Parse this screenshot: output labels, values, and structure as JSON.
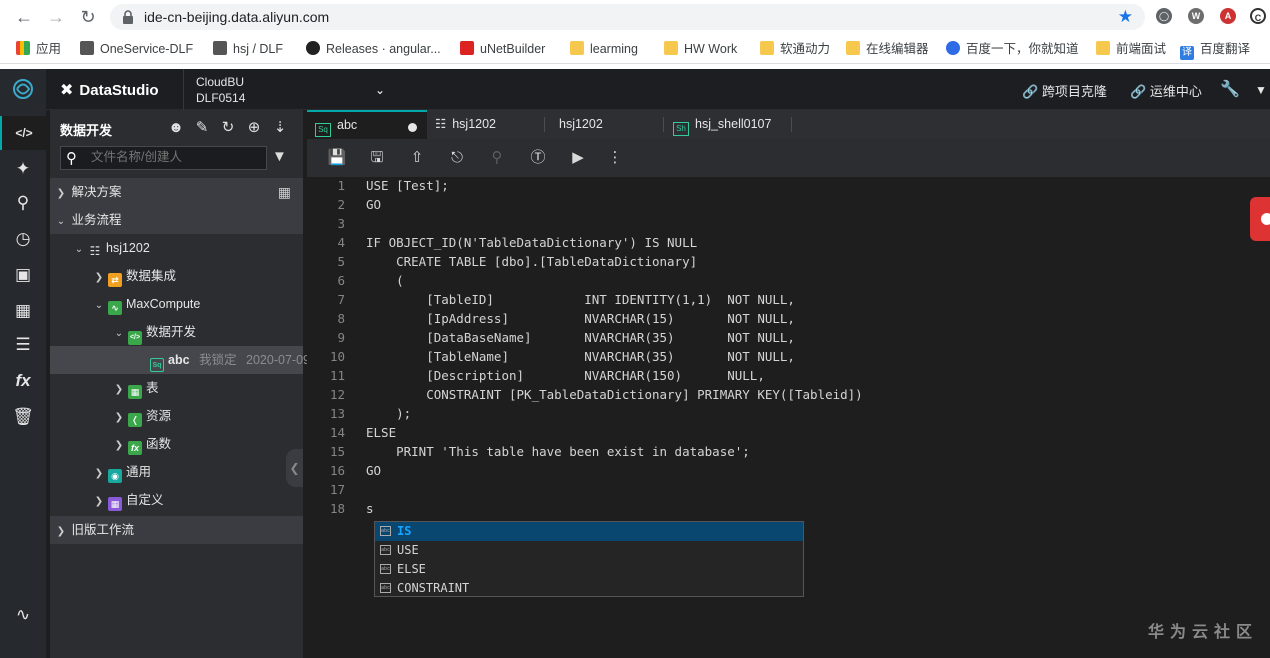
{
  "browser": {
    "url": "ide-cn-beijing.data.aliyun.com",
    "bookmarks": [
      "应用",
      "OneService-DLF",
      "hsj / DLF",
      "Releases · angular...",
      "uNetBuilder",
      "learming",
      "HW Work",
      "软通动力",
      "在线编辑器",
      "百度一下，你就知道",
      "前端面试",
      "百度翻译"
    ]
  },
  "topbar": {
    "brand": "DataStudio",
    "project_line1": "CloudBU",
    "project_line2": "DLF0514",
    "link_clone": "跨项目克隆",
    "link_ops": "运维中心"
  },
  "panel": {
    "title": "数据开发",
    "search_placeholder": "文件名称/创建人",
    "tree": {
      "solutions": "解决方案",
      "workflow": "业务流程",
      "flow_name": "hsj1202",
      "data_integration": "数据集成",
      "maxcompute": "MaxCompute",
      "data_dev": "数据开发",
      "file_name": "abc",
      "file_lock": "我锁定",
      "file_date": "2020-07-09",
      "table": "表",
      "resource": "资源",
      "function": "函数",
      "general": "通用",
      "custom": "自定义",
      "legacy": "旧版工作流"
    }
  },
  "tabs": [
    {
      "label": "abc",
      "icon": "Sq"
    },
    {
      "label": "hsj1202",
      "icon": "flow"
    },
    {
      "label": "hsj1202",
      "icon": ""
    },
    {
      "label": "hsj_shell0107",
      "icon": "Sh"
    }
  ],
  "editor": {
    "lines": [
      "USE [Test];",
      "GO",
      "",
      "IF OBJECT_ID(N'TableDataDictionary') IS NULL",
      "    CREATE TABLE [dbo].[TableDataDictionary]",
      "    (",
      "        [TableID]            INT IDENTITY(1,1)  NOT NULL,",
      "        [IpAddress]          NVARCHAR(15)       NOT NULL,",
      "        [DataBaseName]       NVARCHAR(35)       NOT NULL,",
      "        [TableName]          NVARCHAR(35)       NOT NULL,",
      "        [Description]        NVARCHAR(150)      NULL,",
      "        CONSTRAINT [PK_TableDataDictionary] PRIMARY KEY([Tableid])",
      "    );",
      "ELSE",
      "    PRINT 'This table have been exist in database';",
      "GO",
      "",
      "s"
    ],
    "suggestions": [
      "IS",
      "USE",
      "ELSE",
      "CONSTRAINT"
    ]
  },
  "watermark": "华为云社区"
}
